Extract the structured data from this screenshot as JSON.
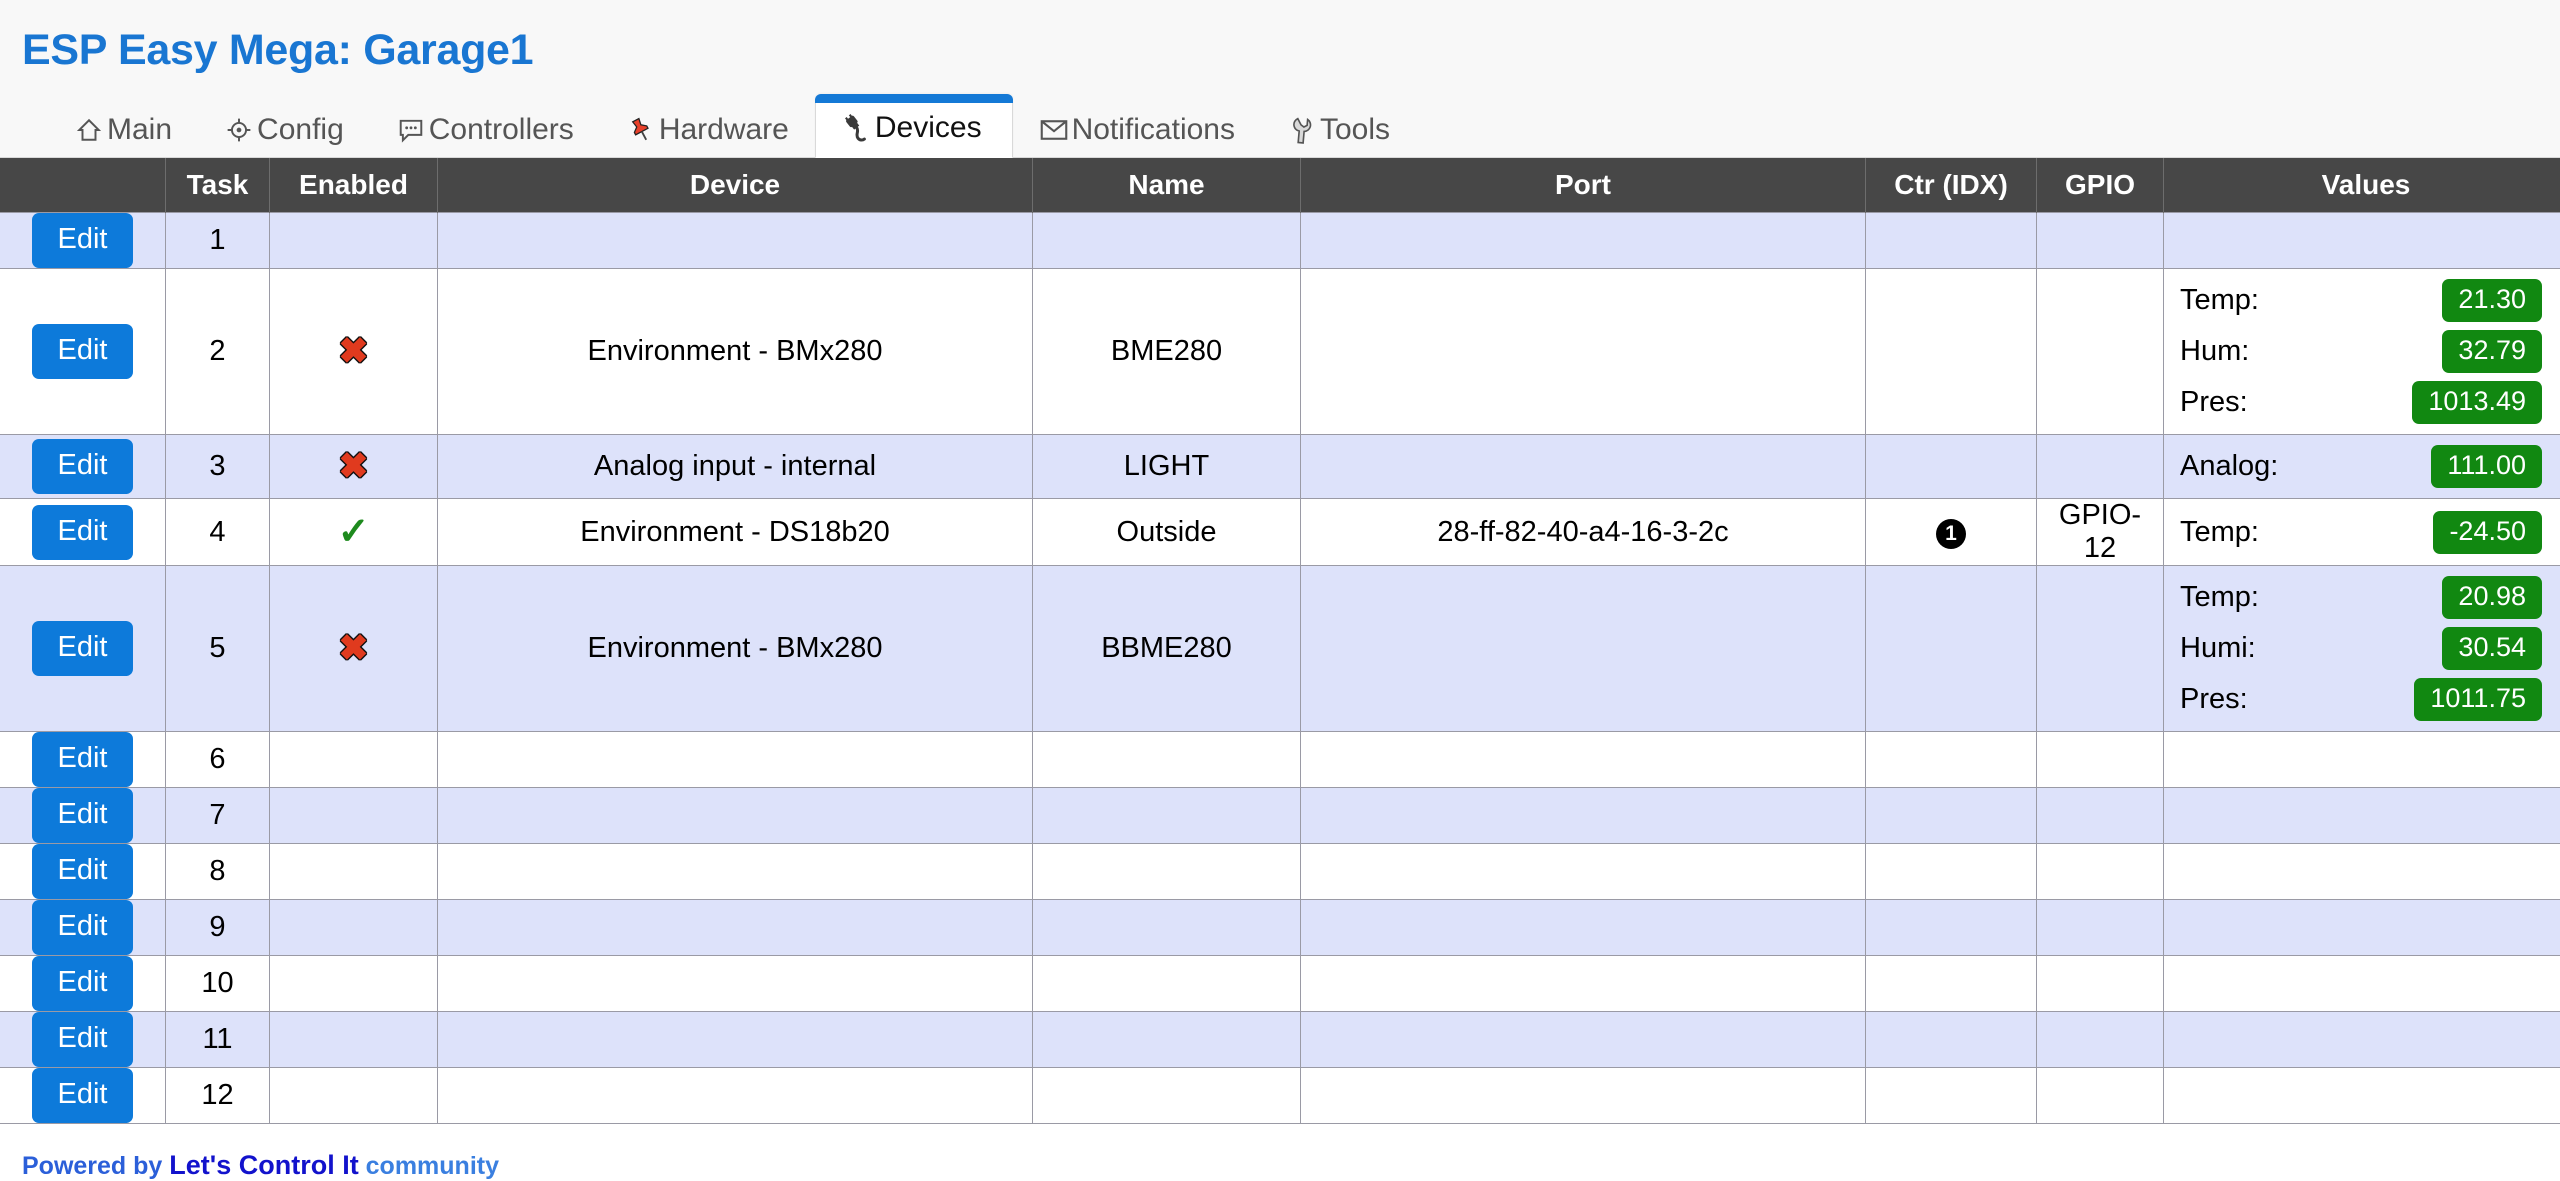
{
  "header": {
    "title": "ESP Easy Mega: Garage1"
  },
  "tabs": [
    {
      "label": "Main",
      "icon": "home-icon",
      "active": false
    },
    {
      "label": "Config",
      "icon": "gear-icon",
      "active": false
    },
    {
      "label": "Controllers",
      "icon": "chat-icon",
      "active": false
    },
    {
      "label": "Hardware",
      "icon": "pushpin-icon",
      "active": false
    },
    {
      "label": "Devices",
      "icon": "plug-icon",
      "active": true
    },
    {
      "label": "Notifications",
      "icon": "envelope-icon",
      "active": false
    },
    {
      "label": "Tools",
      "icon": "wrench-icon",
      "active": false
    }
  ],
  "table": {
    "columns": [
      "",
      "Task",
      "Enabled",
      "Device",
      "Name",
      "Port",
      "Ctr (IDX)",
      "GPIO",
      "Values"
    ],
    "edit_label": "Edit",
    "enabled_true_glyph": "✓",
    "enabled_false_glyph": "✖",
    "rows": [
      {
        "edit": "Edit",
        "task": "1",
        "enabled": "",
        "device": "",
        "name": "",
        "port": "",
        "ctr": "",
        "gpio": "",
        "values": []
      },
      {
        "edit": "Edit",
        "task": "2",
        "enabled": "false",
        "device": "Environment - BMx280",
        "name": "BME280",
        "port": "",
        "ctr": "",
        "gpio": "",
        "values": [
          {
            "label": "Temp:",
            "value": "21.30"
          },
          {
            "label": "Hum:",
            "value": "32.79"
          },
          {
            "label": "Pres:",
            "value": "1013.49"
          }
        ]
      },
      {
        "edit": "Edit",
        "task": "3",
        "enabled": "false",
        "device": "Analog input - internal",
        "name": "LIGHT",
        "port": "",
        "ctr": "",
        "gpio": "",
        "values": [
          {
            "label": "Analog:",
            "value": "111.00"
          }
        ]
      },
      {
        "edit": "Edit",
        "task": "4",
        "enabled": "true",
        "device": "Environment - DS18b20",
        "name": "Outside",
        "port": "28-ff-82-40-a4-16-3-2c",
        "ctr": "1",
        "gpio": "GPIO-12",
        "values": [
          {
            "label": "Temp:",
            "value": "-24.50"
          }
        ]
      },
      {
        "edit": "Edit",
        "task": "5",
        "enabled": "false",
        "device": "Environment - BMx280",
        "name": "BBME280",
        "port": "",
        "ctr": "",
        "gpio": "",
        "values": [
          {
            "label": "Temp:",
            "value": "20.98"
          },
          {
            "label": "Humi:",
            "value": "30.54"
          },
          {
            "label": "Pres:",
            "value": "1011.75"
          }
        ]
      },
      {
        "edit": "Edit",
        "task": "6",
        "enabled": "",
        "device": "",
        "name": "",
        "port": "",
        "ctr": "",
        "gpio": "",
        "values": []
      },
      {
        "edit": "Edit",
        "task": "7",
        "enabled": "",
        "device": "",
        "name": "",
        "port": "",
        "ctr": "",
        "gpio": "",
        "values": []
      },
      {
        "edit": "Edit",
        "task": "8",
        "enabled": "",
        "device": "",
        "name": "",
        "port": "",
        "ctr": "",
        "gpio": "",
        "values": []
      },
      {
        "edit": "Edit",
        "task": "9",
        "enabled": "",
        "device": "",
        "name": "",
        "port": "",
        "ctr": "",
        "gpio": "",
        "values": []
      },
      {
        "edit": "Edit",
        "task": "10",
        "enabled": "",
        "device": "",
        "name": "",
        "port": "",
        "ctr": "",
        "gpio": "",
        "values": []
      },
      {
        "edit": "Edit",
        "task": "11",
        "enabled": "",
        "device": "",
        "name": "",
        "port": "",
        "ctr": "",
        "gpio": "",
        "values": []
      },
      {
        "edit": "Edit",
        "task": "12",
        "enabled": "",
        "device": "",
        "name": "",
        "port": "",
        "ctr": "",
        "gpio": "",
        "values": []
      }
    ]
  },
  "footer": {
    "powered_by": "Powered by",
    "brand": "Let's Control It",
    "community": "community"
  },
  "colors": {
    "title_blue": "#1976d2",
    "tab_active_bar": "#1479d6",
    "header_dark": "#474747",
    "row_alt": "#dde2fa",
    "edit_blue": "#0d7ada",
    "value_green": "#118811",
    "mark_x_red": "#e03a1e",
    "mark_check_green": "#1e8a1e"
  }
}
